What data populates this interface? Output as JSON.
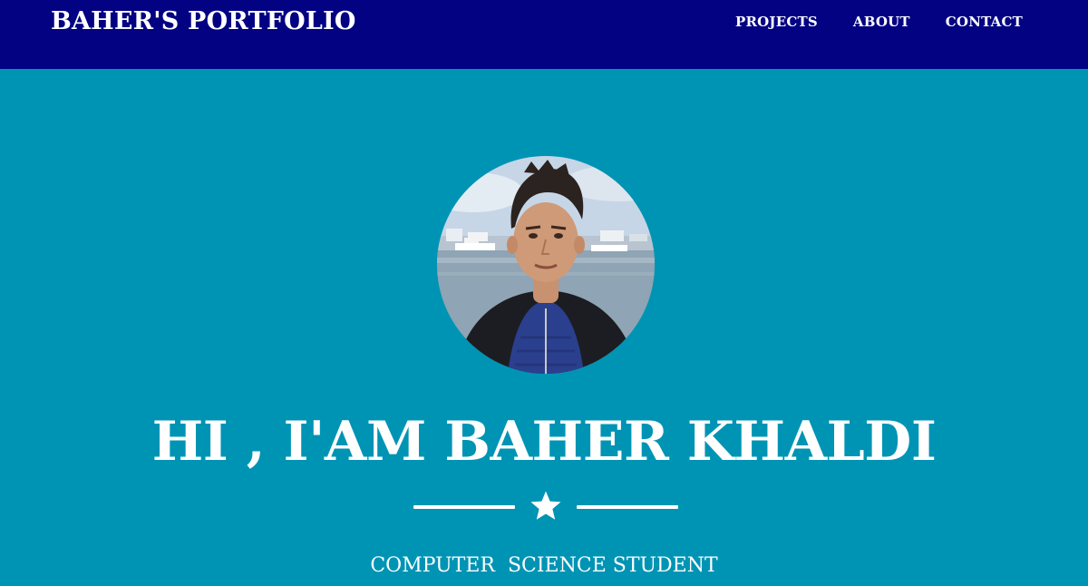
{
  "navbar": {
    "brand": "BAHER'S PORTFOLIO",
    "links": [
      {
        "label": "PROJECTS"
      },
      {
        "label": "ABOUT"
      },
      {
        "label": "CONTACT"
      }
    ],
    "background_color": "#020282"
  },
  "hero": {
    "background_color": "#0094b4",
    "avatar_icon": "profile-photo",
    "title": "HI , I'AM BAHER KHALDI",
    "divider_icon": "star-icon",
    "subtitle": "COMPUTER  SCIENCE STUDENT"
  }
}
